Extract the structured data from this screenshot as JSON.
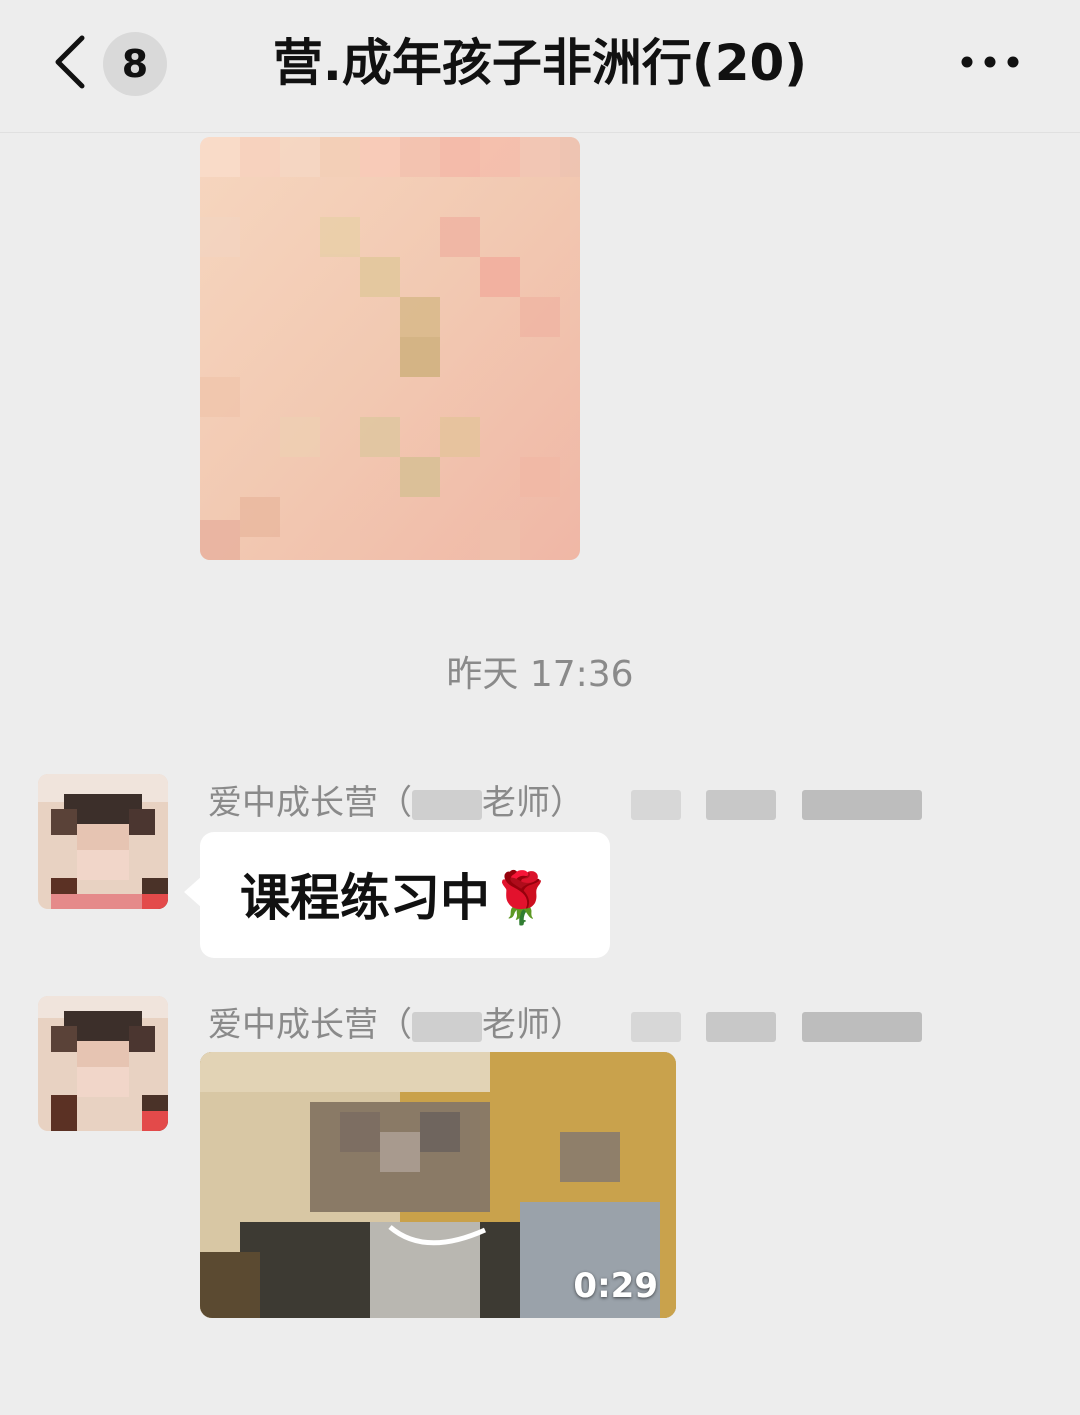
{
  "header": {
    "back_icon": "chevron-left-icon",
    "unread_count": "8",
    "title": "营.成年孩子非洲行(20)",
    "more_icon": "more-dots-icon"
  },
  "messages": {
    "image_message": {
      "type": "image",
      "pixelated": true
    },
    "timestamp": "昨天 17:36",
    "text_message": {
      "sender_prefix": "爱中成长营（",
      "sender_suffix": "老师）",
      "text": "课程练习中",
      "emoji": "🌹"
    },
    "video_message": {
      "sender_prefix": "爱中成长营（",
      "sender_suffix": "老师）",
      "duration": "0:29"
    }
  },
  "colors": {
    "background": "#ededed",
    "bubble": "#ffffff",
    "timestamp": "#8a8a8a",
    "title": "#111111"
  }
}
